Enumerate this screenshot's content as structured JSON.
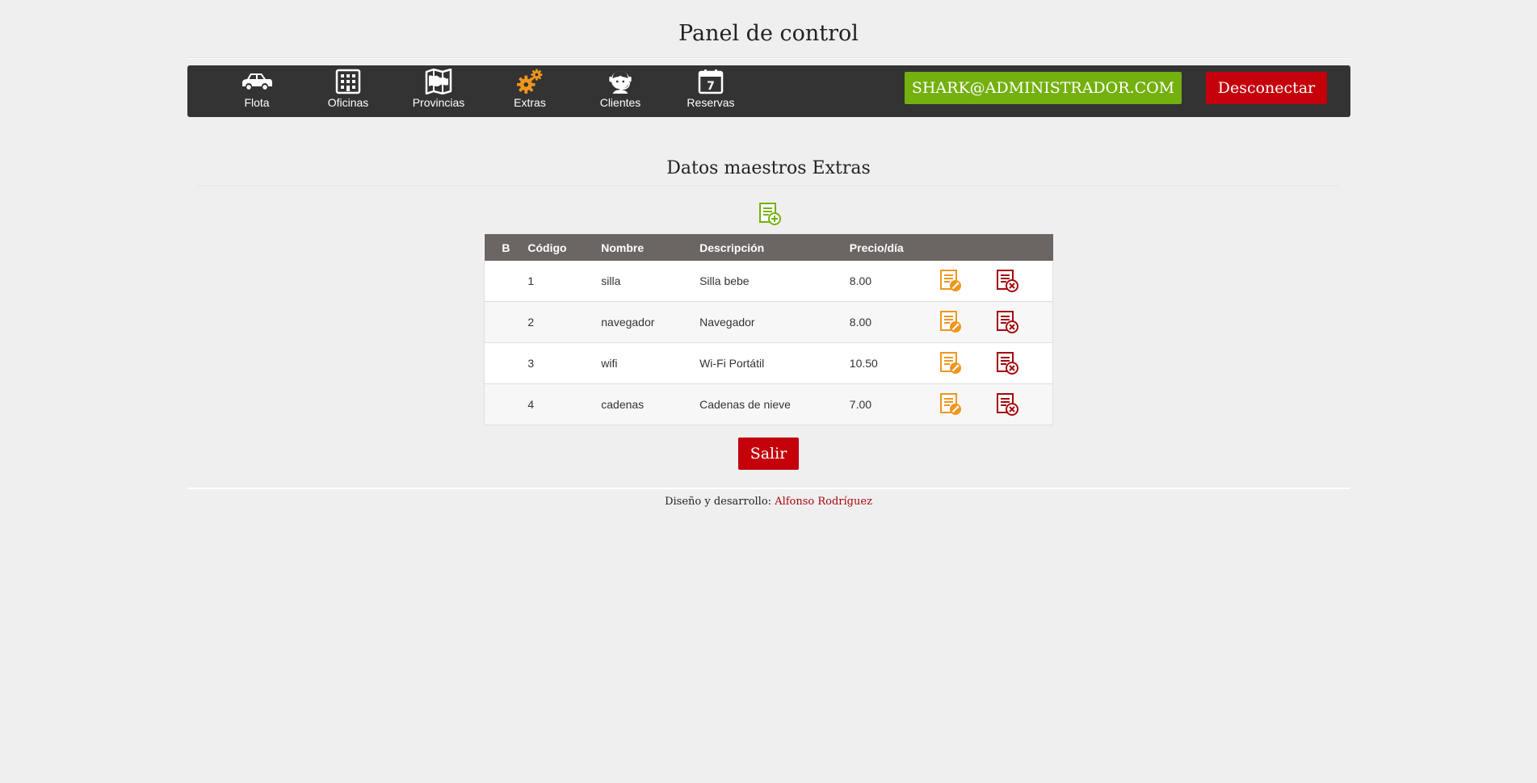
{
  "header": {
    "title": "Panel de control"
  },
  "nav": {
    "items": [
      {
        "label": "Flota",
        "icon": "car-icon"
      },
      {
        "label": "Oficinas",
        "icon": "building-icon"
      },
      {
        "label": "Provincias",
        "icon": "map-icon"
      },
      {
        "label": "Extras",
        "icon": "gears-icon"
      },
      {
        "label": "Clientes",
        "icon": "support-agent-icon"
      },
      {
        "label": "Reservas",
        "icon": "calendar-icon"
      }
    ],
    "calendar_day": "7",
    "user_label": "SHARK@ADMINISTRADOR.COM",
    "logout_label": "Desconectar"
  },
  "main": {
    "title": "Datos maestros Extras",
    "add_icon": "add-record-icon",
    "table": {
      "columns": [
        "B",
        "Código",
        "Nombre",
        "Descripción",
        "Precio/día"
      ],
      "rows": [
        {
          "codigo": "1",
          "nombre": "silla",
          "descripcion": "Silla bebe",
          "precio": "8.00"
        },
        {
          "codigo": "2",
          "nombre": "navegador",
          "descripcion": "Navegador",
          "precio": "8.00"
        },
        {
          "codigo": "3",
          "nombre": "wifi",
          "descripcion": "Wi-Fi Portátil",
          "precio": "10.50"
        },
        {
          "codigo": "4",
          "nombre": "cadenas",
          "descripcion": "Cadenas de nieve",
          "precio": "7.00"
        }
      ]
    },
    "exit_label": "Salir"
  },
  "footer": {
    "prefix": "Diseño y desarrollo:",
    "author": "Alfonso Rodríguez"
  },
  "colors": {
    "navbar": "#333333",
    "accent_green": "#74b00e",
    "accent_red": "#c4000b",
    "edit_orange": "#f0961e",
    "table_header": "#6b6563"
  }
}
